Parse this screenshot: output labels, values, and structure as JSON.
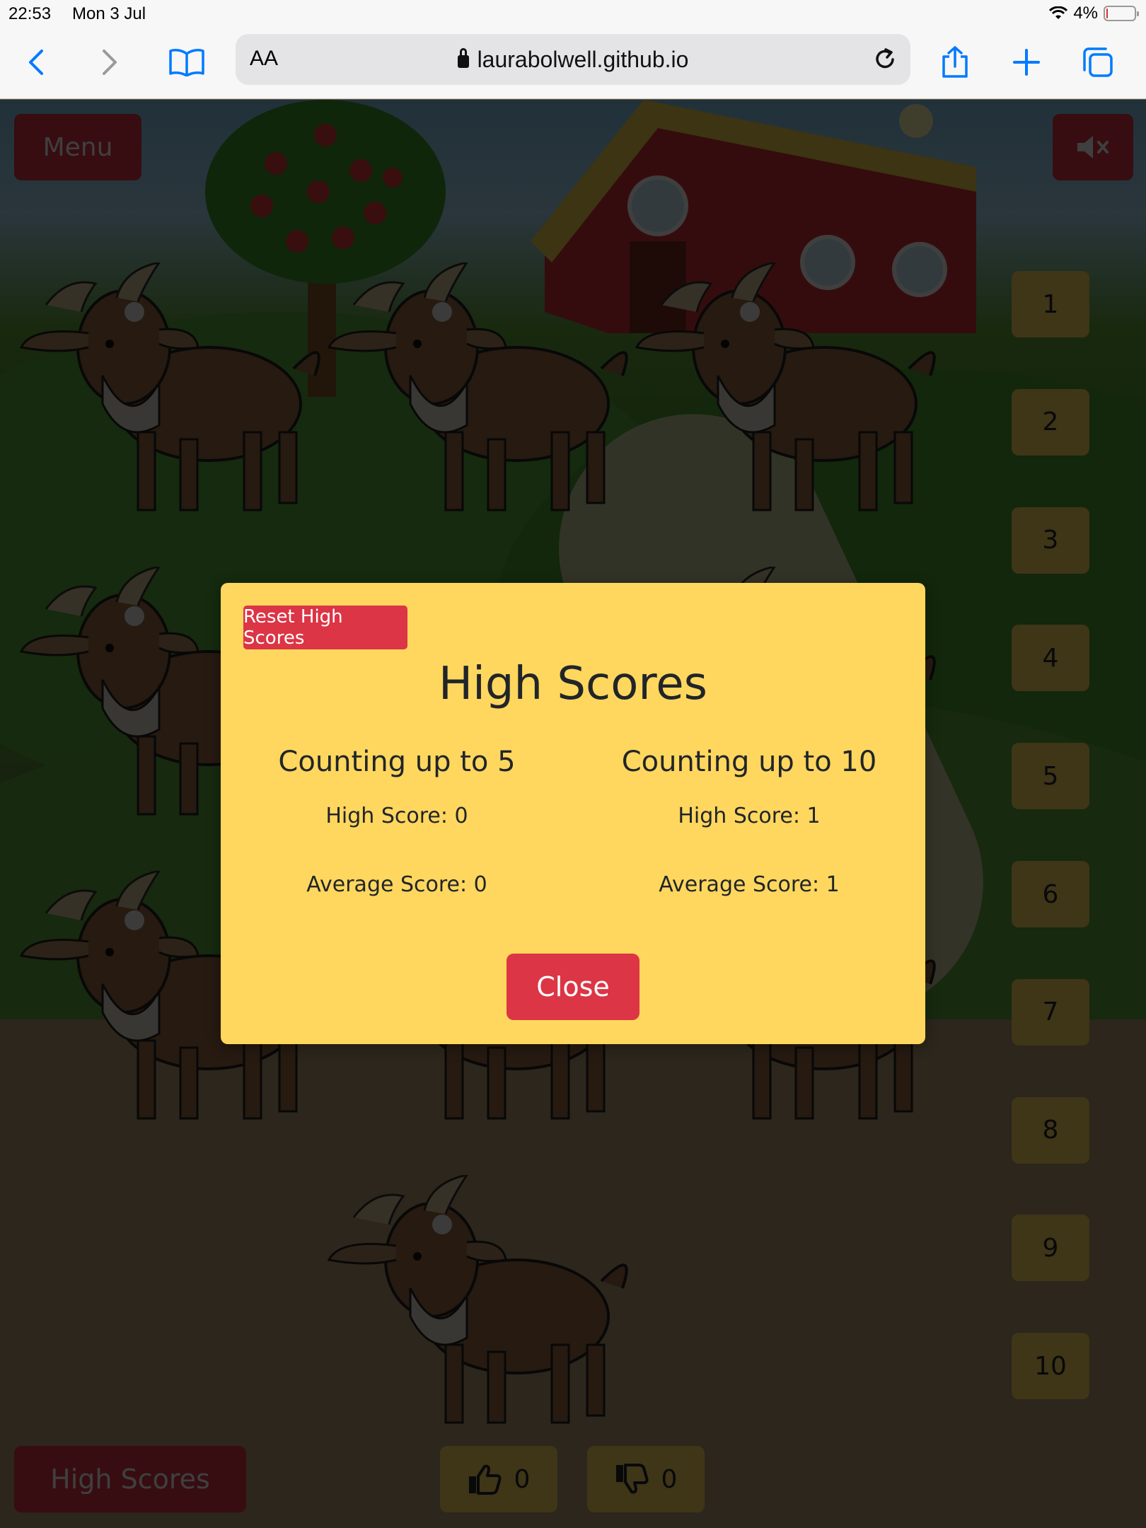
{
  "status_bar": {
    "time": "22:53",
    "date": "Mon 3 Jul",
    "battery": "4%",
    "battery_level": 0.04
  },
  "browser": {
    "aa_label": "AA",
    "url": "laurabolwell.github.io",
    "back_icon": "chevron-left-icon",
    "forward_icon": "chevron-right-icon",
    "bookmarks_icon": "book-icon",
    "reload_icon": "reload-icon",
    "share_icon": "share-icon",
    "new_tab_icon": "plus-icon",
    "tabs_icon": "tabs-icon",
    "accent": "#007aff"
  },
  "game": {
    "menu_label": "Menu",
    "mute_icon": "speaker-muted-icon",
    "number_buttons": [
      "1",
      "2",
      "3",
      "4",
      "5",
      "6",
      "7",
      "8",
      "9",
      "10"
    ],
    "high_scores_label": "High Scores",
    "thumbs_up_count": "0",
    "thumbs_down_count": "0",
    "thumbs_up_icon": "thumbs-up-icon",
    "thumbs_down_icon": "thumbs-down-icon",
    "scene_icons": [
      "goat-icon",
      "barn-icon",
      "apple-tree-icon",
      "sun-icon"
    ],
    "colors": {
      "red": "#dc3545",
      "yellow": "#ffd75e"
    }
  },
  "modal": {
    "reset_label": "Reset High Scores",
    "title": "High Scores",
    "left": {
      "title": "Counting up to 5",
      "high_score": "High Score: 0",
      "average_score": "Average Score: 0"
    },
    "right": {
      "title": "Counting up to 10",
      "high_score": "High Score: 1",
      "average_score": "Average Score: 1"
    },
    "close_label": "Close"
  }
}
